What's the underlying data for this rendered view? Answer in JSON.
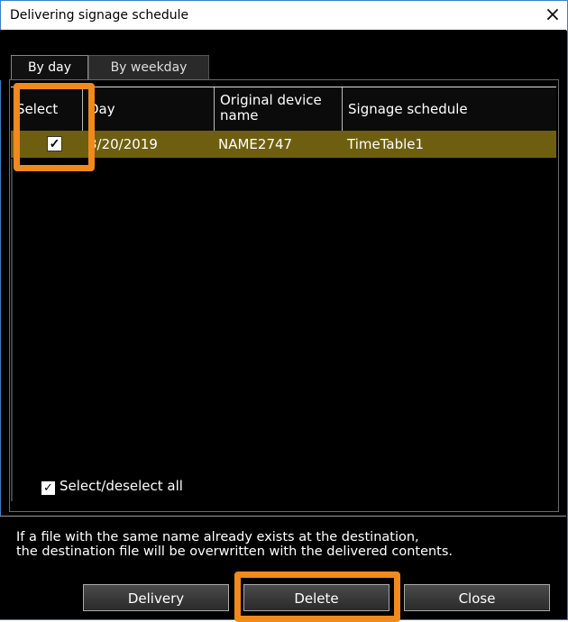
{
  "window": {
    "title": "Delivering signage schedule",
    "close_glyph": "×"
  },
  "tabs": [
    {
      "label": "By day",
      "active": true
    },
    {
      "label": "By weekday",
      "active": false
    }
  ],
  "table": {
    "headers": [
      "Select",
      "Day",
      "Original device name",
      "Signage schedule"
    ],
    "rows": [
      {
        "selected": true,
        "day": "3/20/2019",
        "device": "NAME2747",
        "schedule": "TimeTable1"
      }
    ]
  },
  "select_all": {
    "checked": true,
    "label": "Select/deselect all"
  },
  "notice": {
    "line1": "If a file with the same name already exists at the destination,",
    "line2": "the destination file will be overwritten with the delivered contents."
  },
  "buttons": {
    "delivery": "Delivery",
    "delete": "Delete",
    "close": "Close"
  },
  "icons": {
    "checkbox": "check-icon",
    "close": "close-icon"
  },
  "colors": {
    "selected_row": "#6e5f10",
    "highlight": "#f08a1c",
    "window_border": "#3a7fc8"
  }
}
